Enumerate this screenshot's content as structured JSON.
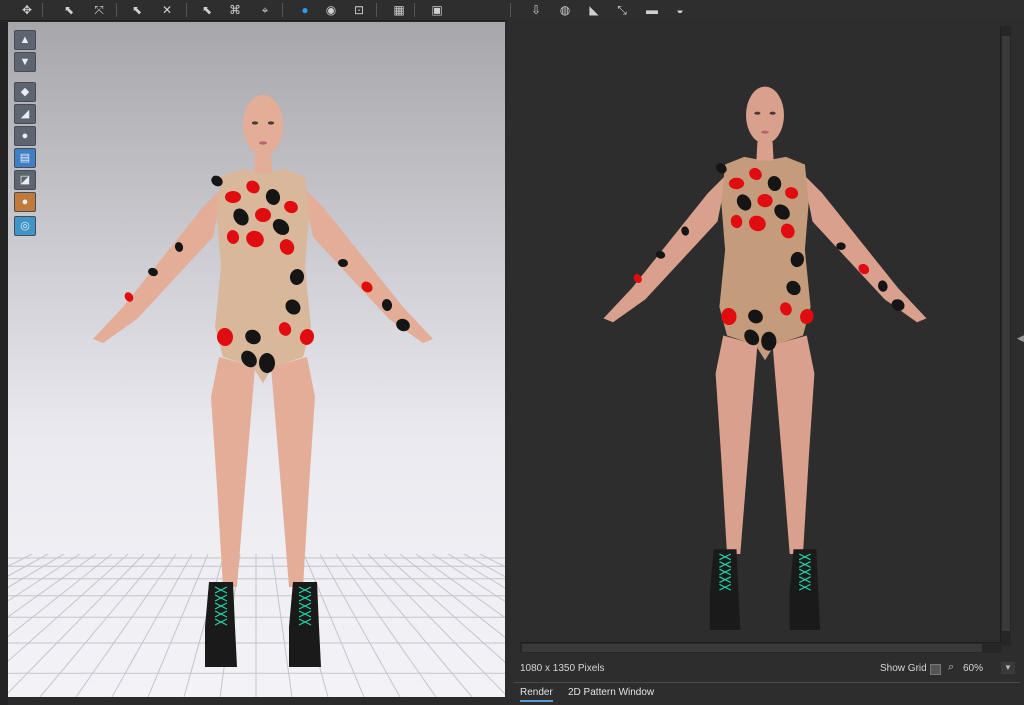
{
  "toolbar": {
    "tools": [
      {
        "name": "select-move-icon",
        "glyph": "✥"
      },
      {
        "name": "edit-pattern-icon",
        "glyph": "⬉"
      },
      {
        "name": "transform-pattern-icon",
        "glyph": "⤧"
      },
      {
        "name": "segment-icon",
        "glyph": "⬉"
      },
      {
        "name": "sewing-icon",
        "glyph": "✕"
      },
      {
        "name": "fold-icon",
        "glyph": "⬉"
      },
      {
        "name": "tack-icon",
        "glyph": "⌘"
      },
      {
        "name": "pin-icon",
        "glyph": "⌖"
      },
      {
        "name": "simulation-icon",
        "glyph": "●"
      },
      {
        "name": "button-tool-icon",
        "glyph": "◉"
      },
      {
        "name": "buttonhole-icon",
        "glyph": "⊡"
      },
      {
        "name": "texture-icon",
        "glyph": "▦"
      },
      {
        "name": "graphic-icon",
        "glyph": "▣"
      },
      {
        "name": "measure-icon",
        "glyph": "⇩"
      },
      {
        "name": "avatar-measure-icon",
        "glyph": "◍"
      },
      {
        "name": "light-icon",
        "glyph": "◣"
      },
      {
        "name": "arrow-tool-icon",
        "glyph": "⤡"
      },
      {
        "name": "camera-icon",
        "glyph": "▬"
      },
      {
        "name": "dome-light-icon",
        "glyph": "◒"
      }
    ]
  },
  "viewport_tools": [
    {
      "name": "avatar-display-icon",
      "glyph": "▲",
      "style": ""
    },
    {
      "name": "garment-display-icon",
      "glyph": "▼",
      "style": ""
    },
    {
      "name": "texture-display-icon",
      "glyph": "◆",
      "style": ""
    },
    {
      "name": "stress-map-icon",
      "glyph": "◢",
      "style": ""
    },
    {
      "name": "avatar-pose-icon",
      "glyph": "●",
      "style": ""
    },
    {
      "name": "render-view-icon",
      "glyph": "▤",
      "style": "blue"
    },
    {
      "name": "camera-view-icon",
      "glyph": "◪",
      "style": ""
    },
    {
      "name": "avatar-skin-icon",
      "glyph": "●",
      "style": "orange"
    },
    {
      "name": "globe-icon",
      "glyph": "◎",
      "style": "globe"
    }
  ],
  "render": {
    "pixels": "1080 x 1350 Pixels",
    "show_grid": "Show Grid",
    "zoom": "60%"
  },
  "tabs": [
    {
      "label": "Render",
      "active": true
    },
    {
      "label": "2D Pattern Window",
      "active": false
    }
  ],
  "colors": {
    "accent": "#2b9cf2",
    "skin_left": "#e3ad98",
    "skin_right": "#d9a08e",
    "spot_red": "#e00c10",
    "spot_black": "#151515",
    "lace": "#21d4a8",
    "boot": "#1a1a1a"
  }
}
